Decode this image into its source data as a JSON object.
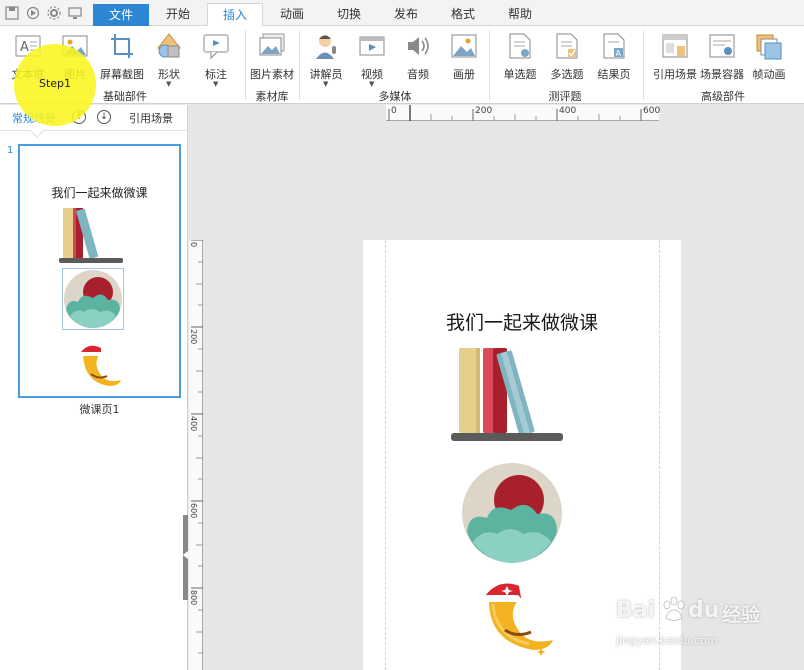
{
  "tabs": {
    "file": "文件",
    "start": "开始",
    "insert": "插入",
    "animation": "动画",
    "transition": "切换",
    "publish": "发布",
    "format": "格式",
    "help": "帮助"
  },
  "ribbon": {
    "text_box": "文本框",
    "image": "图片",
    "screenshot": "屏幕截图",
    "shape": "形状",
    "annotation": "标注",
    "image_material": "图片素材",
    "narrator": "讲解员",
    "video": "视频",
    "audio": "音频",
    "album": "画册",
    "single_choice": "单选题",
    "multi_choice": "多选题",
    "result_page": "结果页",
    "ref_scene": "引用场景",
    "scene_container": "场景容器",
    "frame_animation": "帧动画",
    "groups": {
      "basic": "基础部件",
      "library": "素材库",
      "multimedia": "多媒体",
      "quiz": "测评题",
      "advanced": "高级部件"
    }
  },
  "left_panel": {
    "tab_normal": "常规场景",
    "tab_ref": "引用场景",
    "slide_number": "1",
    "slide_title": "我们一起来做微课",
    "slide_caption": "微课页1"
  },
  "canvas": {
    "title": "我们一起来做微课",
    "hruler_labels": [
      "0",
      "200",
      "400",
      "600"
    ],
    "vruler_labels": [
      "0",
      "200",
      "400",
      "600",
      "800"
    ]
  },
  "highlight": {
    "label": "Step1"
  },
  "watermark": {
    "brand_a": "Bai",
    "brand_b": "du",
    "brand_c": "经验",
    "url": "jingyan.baidu.com"
  },
  "colors": {
    "accent": "#2b87d3",
    "highlight": "#faf51e",
    "book_yellow": "#e6cf8b",
    "book_red": "#a8202b",
    "book_teal": "#7fb5c0",
    "shelf": "#5b5b5b"
  }
}
